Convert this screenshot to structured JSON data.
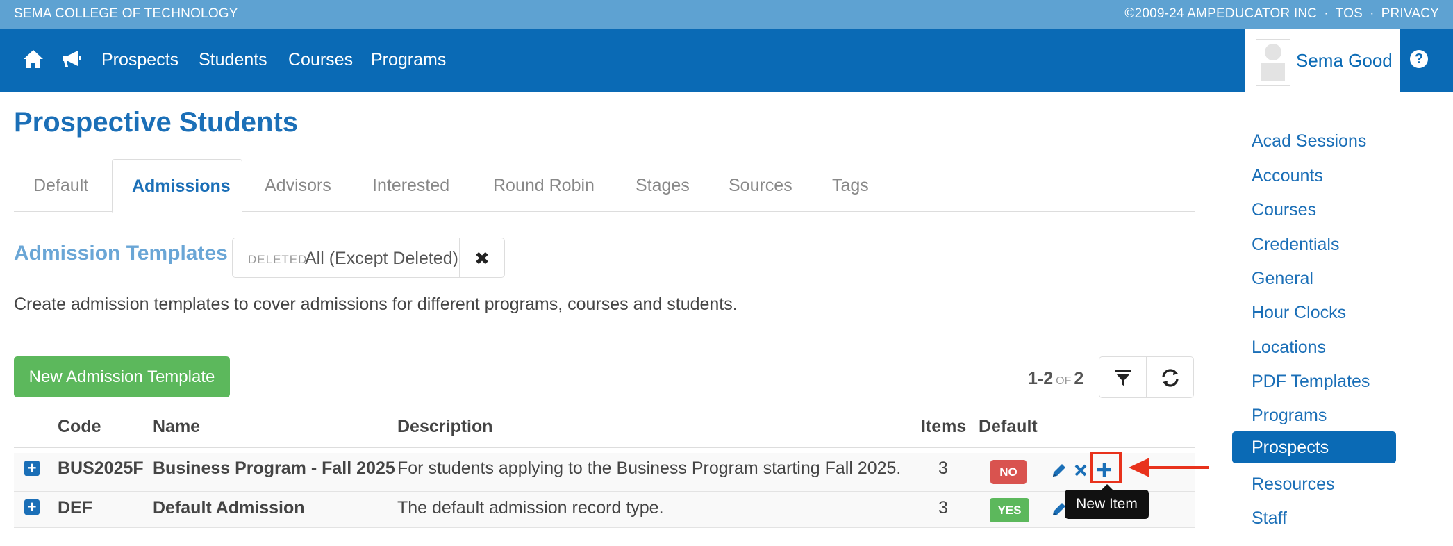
{
  "topbar": {
    "college": "SEMA COLLEGE OF TECHNOLOGY",
    "copyright": "©2009-24 AMPEDUCATOR INC",
    "tos": "TOS",
    "privacy": "PRIVACY",
    "separator": "·"
  },
  "nav": {
    "items": [
      "Prospects",
      "Students",
      "Courses",
      "Programs"
    ],
    "user": "Sema Good",
    "help": "?"
  },
  "page": {
    "title": "Prospective Students",
    "tabs": [
      "Default",
      "Admissions",
      "Advisors",
      "Interested",
      "Round Robin",
      "Stages",
      "Sources",
      "Tags"
    ],
    "active_tab": "Admissions"
  },
  "section": {
    "title": "Admission Templates",
    "filter_label": "DELETED",
    "filter_value": "All (Except Deleted)",
    "clear_symbol": "✖",
    "description": "Create admission templates to cover admissions for different programs, courses and students."
  },
  "toolbar": {
    "new_button": "New Admission Template",
    "pager_range": "1-2",
    "pager_of": "OF",
    "pager_total": "2"
  },
  "table": {
    "headers": [
      "Code",
      "Name",
      "Description",
      "Items",
      "Default"
    ],
    "rows": [
      {
        "code": "BUS2025F",
        "name": "Business Program - Fall 2025",
        "description": "For students applying to the Business Program starting Fall 2025.",
        "items": "3",
        "default": "NO"
      },
      {
        "code": "DEF",
        "name": "Default Admission",
        "description": "The default admission record type.",
        "items": "3",
        "default": "YES"
      }
    ]
  },
  "tooltip": "New Item",
  "sidebar": {
    "items": [
      "Acad Sessions",
      "Accounts",
      "Courses",
      "Credentials",
      "General",
      "Hour Clocks",
      "Locations",
      "PDF Templates",
      "Programs",
      "Prospects",
      "Resources",
      "Staff"
    ],
    "active": "Prospects"
  },
  "colors": {
    "topbar": "#5ea2d2",
    "navbar": "#0a6ab5",
    "accent": "#1b6fb7",
    "success": "#5cb85c",
    "danger": "#d9534f",
    "highlight": "#e8321c"
  }
}
